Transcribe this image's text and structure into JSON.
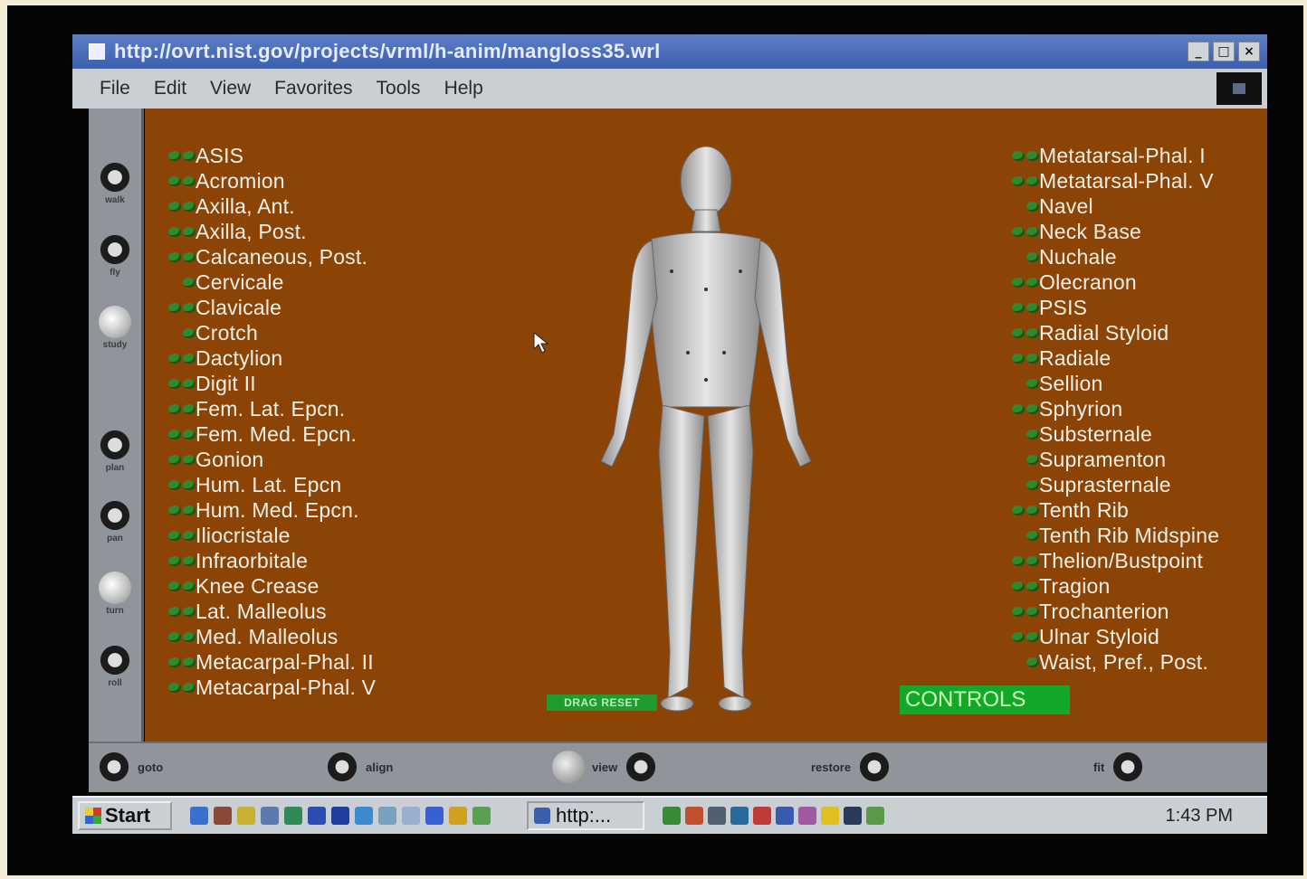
{
  "window": {
    "title": "http://ovrt.nist.gov/projects/vrml/h-anim/mangloss35.wrl",
    "controls": [
      "_",
      "□",
      "×"
    ]
  },
  "menu": [
    "File",
    "Edit",
    "View",
    "Favorites",
    "Tools",
    "Help"
  ],
  "nav_sidebar": [
    {
      "label": "walk",
      "icon": "walk-icon"
    },
    {
      "label": "fly",
      "icon": "fly-icon"
    },
    {
      "label": "study",
      "icon": "study-icon"
    },
    {
      "label": "plan",
      "icon": "plan-icon"
    },
    {
      "label": "pan",
      "icon": "pan-icon"
    },
    {
      "label": "turn",
      "icon": "turn-icon"
    },
    {
      "label": "roll",
      "icon": "roll-icon"
    }
  ],
  "landmarks_left": [
    {
      "label": "ASIS",
      "dots": 2
    },
    {
      "label": "Acromion",
      "dots": 2
    },
    {
      "label": "Axilla, Ant.",
      "dots": 2
    },
    {
      "label": "Axilla, Post.",
      "dots": 2
    },
    {
      "label": "Calcaneous, Post.",
      "dots": 2
    },
    {
      "label": "Cervicale",
      "dots": 1
    },
    {
      "label": "Clavicale",
      "dots": 2
    },
    {
      "label": "Crotch",
      "dots": 1
    },
    {
      "label": "Dactylion",
      "dots": 2
    },
    {
      "label": "Digit II",
      "dots": 2
    },
    {
      "label": "Fem. Lat. Epcn.",
      "dots": 2
    },
    {
      "label": "Fem. Med. Epcn.",
      "dots": 2
    },
    {
      "label": "Gonion",
      "dots": 2
    },
    {
      "label": "Hum. Lat. Epcn",
      "dots": 2
    },
    {
      "label": "Hum. Med. Epcn.",
      "dots": 2
    },
    {
      "label": "Iliocristale",
      "dots": 2
    },
    {
      "label": "Infraorbitale",
      "dots": 2
    },
    {
      "label": "Knee Crease",
      "dots": 2
    },
    {
      "label": "Lat. Malleolus",
      "dots": 2
    },
    {
      "label": "Med. Malleolus",
      "dots": 2
    },
    {
      "label": "Metacarpal-Phal. II",
      "dots": 2
    },
    {
      "label": "Metacarpal-Phal. V",
      "dots": 2
    }
  ],
  "landmarks_right": [
    {
      "label": "Metatarsal-Phal. I",
      "dots": 2
    },
    {
      "label": "Metatarsal-Phal. V",
      "dots": 2
    },
    {
      "label": "Navel",
      "dots": 1
    },
    {
      "label": "Neck Base",
      "dots": 2
    },
    {
      "label": "Nuchale",
      "dots": 1
    },
    {
      "label": "Olecranon",
      "dots": 2
    },
    {
      "label": "PSIS",
      "dots": 2
    },
    {
      "label": "Radial Styloid",
      "dots": 2
    },
    {
      "label": "Radiale",
      "dots": 2
    },
    {
      "label": "Sellion",
      "dots": 1
    },
    {
      "label": "Sphyrion",
      "dots": 2
    },
    {
      "label": "Substernale",
      "dots": 1
    },
    {
      "label": "Supramenton",
      "dots": 1
    },
    {
      "label": "Suprasternale",
      "dots": 1
    },
    {
      "label": "Tenth Rib",
      "dots": 2
    },
    {
      "label": "Tenth Rib Midspine",
      "dots": 1
    },
    {
      "label": "Thelion/Bustpoint",
      "dots": 2
    },
    {
      "label": "Tragion",
      "dots": 2
    },
    {
      "label": "Trochanterion",
      "dots": 2
    },
    {
      "label": "Ulnar Styloid",
      "dots": 2
    },
    {
      "label": "Waist, Pref., Post.",
      "dots": 1
    }
  ],
  "buttons": {
    "drag_reset": "DRAG RESET",
    "controls": "CONTROLS"
  },
  "bottom_toolbar": {
    "goto": "goto",
    "align": "align",
    "view": "view",
    "restore": "restore",
    "fit": "fit"
  },
  "taskbar": {
    "start": "Start",
    "task": "http:...",
    "clock": "1:43 PM"
  },
  "colors": {
    "viewport_bg": "#8b4306",
    "landmark_dot": "#2f8a2f",
    "controls_btn": "#14a82a",
    "titlebar": "#3a5fae"
  }
}
